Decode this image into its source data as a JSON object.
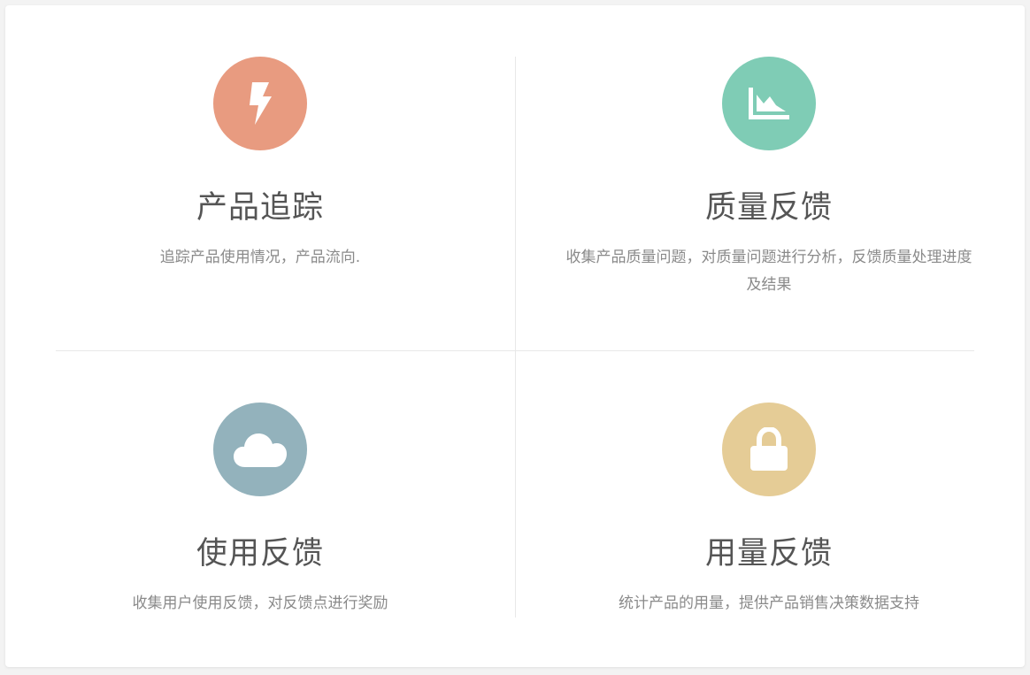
{
  "features": [
    {
      "title": "产品追踪",
      "description": "追踪产品使用情况，产品流向.",
      "icon": "lightning-icon",
      "color": "#E89B80"
    },
    {
      "title": "质量反馈",
      "description": "收集产品质量问题，对质量问题进行分析，反馈质量处理进度及结果",
      "icon": "area-chart-icon",
      "color": "#7FCCB5"
    },
    {
      "title": "使用反馈",
      "description": "收集用户使用反馈，对反馈点进行奖励",
      "icon": "cloud-icon",
      "color": "#93B2BC"
    },
    {
      "title": "用量反馈",
      "description": "统计产品的用量，提供产品销售决策数据支持",
      "icon": "lock-icon",
      "color": "#E5CC96"
    }
  ]
}
